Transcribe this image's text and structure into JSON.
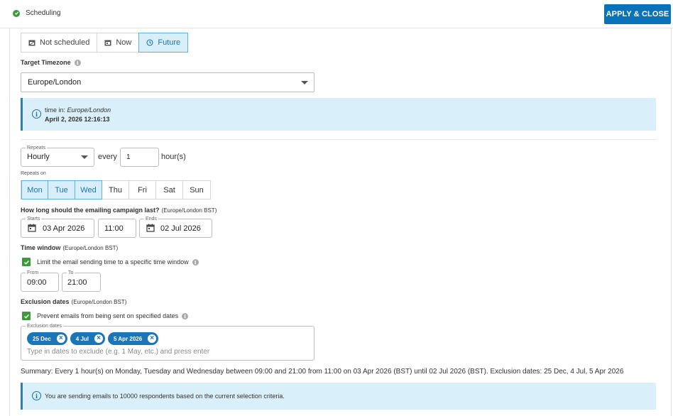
{
  "header": {
    "title": "Scheduling",
    "apply_label": "APPLY & CLOSE",
    "accent": "#0a72b8",
    "status_color": "#3c9a3c"
  },
  "mode_tabs": [
    {
      "label": "Not scheduled",
      "icon": "calendar-off-icon",
      "active": false
    },
    {
      "label": "Now",
      "icon": "calendar-now-icon",
      "active": false
    },
    {
      "label": "Future",
      "icon": "clock-icon",
      "active": true
    }
  ],
  "timezone": {
    "label": "Target Timezone",
    "value": "Europe/London"
  },
  "time_info": {
    "prefix": "time in:",
    "zone": "Europe/London",
    "datetime": "April 2, 2026 12:16:13"
  },
  "repeats": {
    "legend": "Repeats",
    "value": "Hourly",
    "every_label": "every",
    "interval": "1",
    "unit_label": "hour(s)"
  },
  "repeats_on": {
    "label": "Repeats on",
    "days": [
      {
        "label": "Mon",
        "selected": true
      },
      {
        "label": "Tue",
        "selected": true
      },
      {
        "label": "Wed",
        "selected": true
      },
      {
        "label": "Thu",
        "selected": false
      },
      {
        "label": "Fri",
        "selected": false
      },
      {
        "label": "Sat",
        "selected": false
      },
      {
        "label": "Sun",
        "selected": false
      }
    ]
  },
  "duration": {
    "label": "How long should the emailing campaign last?",
    "tz_note": "(Europe/London BST)",
    "starts_legend": "Starts",
    "start_date": "03 Apr 2026",
    "start_time": "11:00",
    "ends_legend": "Ends",
    "end_date": "02 Jul 2026"
  },
  "time_window": {
    "label": "Time window",
    "tz_note": "(Europe/London BST)",
    "checkbox_label": "Limit the email sending time to a specific time window",
    "checked": true,
    "from_legend": "From",
    "from": "09:00",
    "to_legend": "To",
    "to": "21:00"
  },
  "exclusion": {
    "label": "Exclusion dates",
    "tz_note": "(Europe/London BST)",
    "checkbox_label": "Prevent emails from being sent on specified dates",
    "checked": true,
    "legend": "Exclusion dates",
    "chips": [
      "25 Dec",
      "4 Jul",
      "5 Apr 2026"
    ],
    "placeholder": "Type in dates to exclude (e.g. 1 May, etc.) and press enter"
  },
  "summary": "Summary: Every 1 hour(s) on Monday, Tuesday and Wednesday between 09:00 and 21:00 from 11:00 on 03 Apr 2026 (BST) until 02 Jul 2026 (BST). Exclusion dates: 25 Dec, 4 Jul, 5 Apr 2026",
  "recipients_info": "You are sending emails to 10000 respondents based on the current selection criteria."
}
